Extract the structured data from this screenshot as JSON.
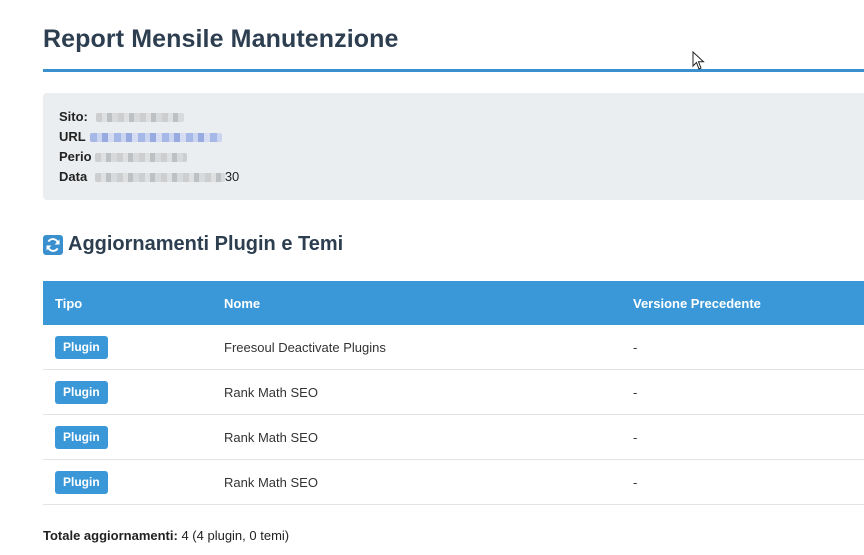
{
  "report": {
    "title": "Report Mensile Manutenzione",
    "info": [
      {
        "label": "Sito:",
        "value_suffix": ""
      },
      {
        "label": "URL",
        "value_suffix": ""
      },
      {
        "label": "Perio",
        "value_suffix": ""
      },
      {
        "label": "Data",
        "value_suffix": "30"
      }
    ]
  },
  "updates": {
    "section_title": "Aggiornamenti Plugin e Temi",
    "icon": "refresh-icon",
    "columns": [
      "Tipo",
      "Nome",
      "Versione Precedente"
    ],
    "rows": [
      {
        "tipo": "Plugin",
        "nome": "Freesoul Deactivate Plugins",
        "versione": "-"
      },
      {
        "tipo": "Plugin",
        "nome": "Rank Math SEO",
        "versione": "-"
      },
      {
        "tipo": "Plugin",
        "nome": "Rank Math SEO",
        "versione": "-"
      },
      {
        "tipo": "Plugin",
        "nome": "Rank Math SEO",
        "versione": "-"
      }
    ],
    "total_label": "Totale aggiornamenti:",
    "total_value": "4 (4 plugin, 0 temi)"
  },
  "colors": {
    "accent": "#3a98d8",
    "heading": "#2c3e50",
    "info_bg": "#ebeef0"
  }
}
